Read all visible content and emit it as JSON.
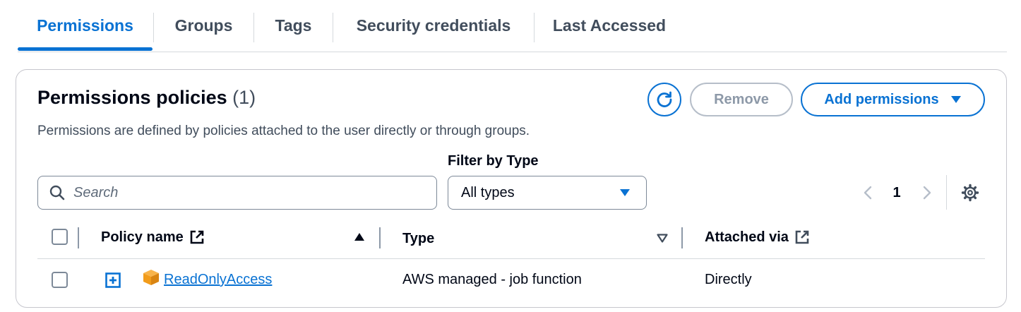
{
  "tabs": [
    {
      "label": "Permissions",
      "active": true
    },
    {
      "label": "Groups",
      "active": false
    },
    {
      "label": "Tags",
      "active": false
    },
    {
      "label": "Security credentials",
      "active": false
    },
    {
      "label": "Last Accessed",
      "active": false
    }
  ],
  "header": {
    "title": "Permissions policies",
    "count": "(1)",
    "description": "Permissions are defined by policies attached to the user directly or through groups."
  },
  "actions": {
    "refresh_icon": "refresh-icon",
    "remove_label": "Remove",
    "add_label": "Add permissions"
  },
  "filter": {
    "search_placeholder": "Search",
    "search_value": "",
    "type_label": "Filter by Type",
    "type_value": "All types"
  },
  "pagination": {
    "current_page": "1"
  },
  "table": {
    "columns": {
      "policy_name": "Policy name",
      "type": "Type",
      "attached_via": "Attached via"
    },
    "sort": {
      "column": "policy_name",
      "direction": "ascending"
    },
    "rows": [
      {
        "policy_name": "ReadOnlyAccess",
        "type": "AWS managed - job function",
        "attached_via": "Directly",
        "checked": false
      }
    ]
  },
  "colors": {
    "accent": "#0972d3",
    "text": "#000716",
    "secondary_text": "#414d5c",
    "disabled": "#8d99a8",
    "policy_icon": "#f29c1b"
  }
}
